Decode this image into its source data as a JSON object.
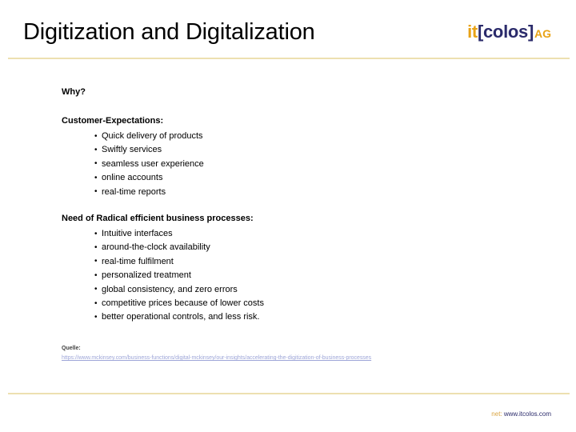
{
  "slide": {
    "title": "Digitization and Digitalization",
    "logo": {
      "it": "it",
      "bracket_open": "[",
      "colos": "colos",
      "bracket_close": "]",
      "ag": "AG",
      "color_it": "#E8A317",
      "color_colos": "#2B2B6B",
      "color_ag": "#E8A317"
    },
    "rule_color": "#EDE0B0",
    "content": {
      "intro_heading": "Why?",
      "sections": [
        {
          "heading": "Customer-Expectations:",
          "bullets": [
            "Quick delivery of products",
            "Swiftly services",
            "seamless user experience",
            "online accounts",
            "real-time reports"
          ]
        },
        {
          "heading": "Need of Radical efficient business processes:",
          "bullets": [
            "Intuitive interfaces",
            "around-the-clock availability",
            "real-time fulfilment",
            "personalized treatment",
            "global consistency, and zero errors",
            "competitive prices because of lower costs",
            "better operational controls, and less risk."
          ]
        }
      ]
    },
    "source": {
      "label": "Quelle:",
      "url": "https://www.mckinsey.com/business-functions/digital-mckinsey/our-insights/accelerating-the-digitization-of-business-processes"
    },
    "footer": {
      "net_label": "net:",
      "site": "www.itcolos.com",
      "color_net": "#D9A441",
      "color_site": "#2B2B6B"
    }
  }
}
